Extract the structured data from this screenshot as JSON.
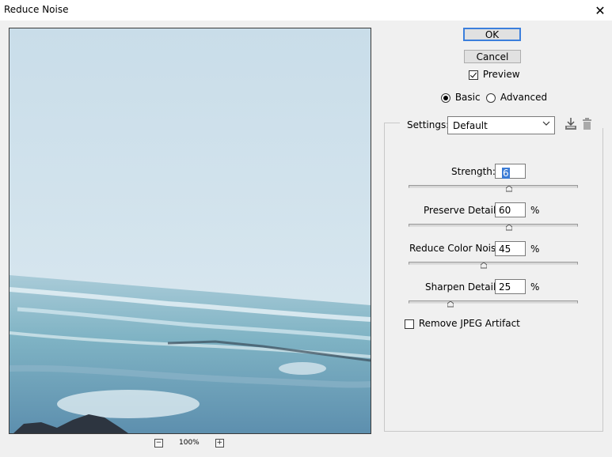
{
  "window": {
    "title": "Reduce Noise",
    "close_glyph": "✕"
  },
  "buttons": {
    "ok": "OK",
    "cancel": "Cancel"
  },
  "preview_checkbox": {
    "label": "Preview",
    "checked": true
  },
  "mode": {
    "options": [
      "Basic",
      "Advanced"
    ],
    "selected": "Basic"
  },
  "settings": {
    "label": "Settings:",
    "value": "Default"
  },
  "sliders": [
    {
      "label": "Strength:",
      "value": "6",
      "unit": "",
      "fraction": 0.6
    },
    {
      "label": "Preserve Details:",
      "value": "60",
      "unit": "%",
      "fraction": 0.6
    },
    {
      "label": "Reduce Color Noise:",
      "value": "45",
      "unit": "%",
      "fraction": 0.45
    },
    {
      "label": "Sharpen Details:",
      "value": "25",
      "unit": "%",
      "fraction": 0.25
    }
  ],
  "jpeg_checkbox": {
    "label": "Remove JPEG Artifact",
    "checked": false
  },
  "zoom": {
    "minus": "−",
    "plus": "+",
    "value": "100%"
  },
  "icons": [
    "save-preset-icon",
    "delete-preset-icon",
    "close-icon",
    "zoom-out-icon",
    "zoom-in-icon"
  ]
}
